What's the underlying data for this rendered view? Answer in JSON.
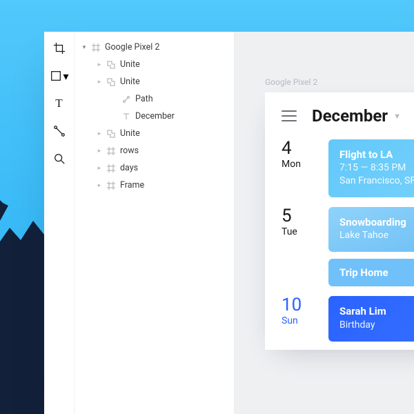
{
  "tool_rail": {
    "items": [
      "crop",
      "rectangle",
      "text",
      "pen",
      "search"
    ]
  },
  "layers": {
    "root_label": "Google Pixel 2",
    "items": [
      {
        "label": "Unite",
        "icon": "union",
        "depth": 1
      },
      {
        "label": "Unite",
        "icon": "union",
        "depth": 1
      },
      {
        "label": "Path",
        "icon": "path",
        "depth": 2
      },
      {
        "label": "December",
        "icon": "text",
        "depth": 2
      },
      {
        "label": "Unite",
        "icon": "union",
        "depth": 1
      },
      {
        "label": "rows",
        "icon": "frame",
        "depth": 1
      },
      {
        "label": "days",
        "icon": "frame",
        "depth": 1
      },
      {
        "label": "Frame",
        "icon": "frame",
        "depth": 1
      }
    ]
  },
  "canvas": {
    "artboard_label": "Google Pixel 2",
    "header": {
      "month": "December"
    },
    "days": [
      {
        "num": "4",
        "dow": "Mon",
        "accent": false,
        "events": [
          {
            "style": "ev-flight",
            "title": "Flight to LA",
            "line2": "7:15 — 8:35 PM",
            "line3": "San Francisco, SFO"
          }
        ]
      },
      {
        "num": "5",
        "dow": "Tue",
        "accent": false,
        "events": [
          {
            "style": "ev-snow",
            "title": "Snowboarding",
            "line2": "Lake Tahoe"
          },
          {
            "style": "ev-trip",
            "title": "Trip Home"
          }
        ]
      },
      {
        "num": "10",
        "dow": "Sun",
        "accent": true,
        "events": [
          {
            "style": "ev-sarah",
            "title": "Sarah Lim",
            "line2": "Birthday"
          }
        ]
      }
    ]
  }
}
